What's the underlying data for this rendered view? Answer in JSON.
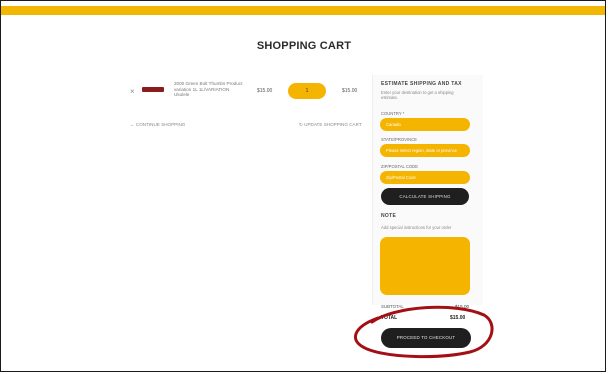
{
  "header": {
    "title": "SHOPPING CART",
    "accent_color": "#f2b705"
  },
  "cart": {
    "items": [
      {
        "remove_label": "×",
        "name": "2000 Green Bolt Thumbs Product variation 1L 1L/VARIATION Ukulele",
        "price": "$15.00",
        "quantity": "1",
        "line_total": "$15.00"
      }
    ],
    "continue_label": "← CONTINUE SHOPPING",
    "update_label": "↻ UPDATE SHOPPING CART"
  },
  "sidebar": {
    "shipping_heading": "ESTIMATE SHIPPING AND TAX",
    "shipping_text": "Enter your destination to get a shipping estimate.",
    "country_label": "COUNTRY *",
    "country_value": "Canada",
    "state_label": "STATE/PROVINCE",
    "state_value": "Please select region, state or province",
    "zip_label": "ZIP/POSTAL CODE",
    "zip_placeholder": "Zip/Postal Code",
    "calculate_label": "CALCULATE SHIPPING",
    "note_heading": "NOTE",
    "note_text": "Add special instructions for your order",
    "subtotal_label": "SUBTOTAL",
    "subtotal_value": "$15.00",
    "total_label": "TOTAL",
    "total_value": "$15.00",
    "checkout_label": "PROCEED TO CHECKOUT",
    "field_color": "#f5b400",
    "button_color": "#1f1f1f"
  },
  "annotation": {
    "color": "#a30f14",
    "shape": "hand-drawn-ellipse"
  }
}
